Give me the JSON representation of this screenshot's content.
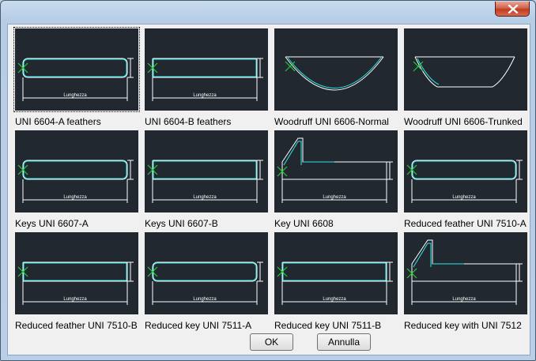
{
  "window": {
    "close_icon": "close-icon",
    "colors": {
      "thumbnail_bg": "#222830",
      "profile_line": "#ffffff",
      "profile_fill_line": "#2ee6e6",
      "marker": "#22cc33"
    }
  },
  "items": [
    {
      "label": "UNI 6604-A feathers",
      "shape": "rect-slot",
      "selected": true
    },
    {
      "label": "UNI 6604-B feathers",
      "shape": "rect-flat",
      "selected": false
    },
    {
      "label": "Woodruff UNI 6606-Normal",
      "shape": "half-moon",
      "selected": false
    },
    {
      "label": "Woodruff UNI 6606-Trunked",
      "shape": "half-moon-truncated",
      "selected": false
    },
    {
      "label": "Keys UNI 6607-A",
      "shape": "rect-slot",
      "selected": false
    },
    {
      "label": "Keys UNI 6607-B",
      "shape": "rect-flat",
      "selected": false
    },
    {
      "label": "Key UNI 6608",
      "shape": "gib-head",
      "selected": false
    },
    {
      "label": "Reduced feather UNI 7510-A",
      "shape": "rect-slot",
      "selected": false
    },
    {
      "label": "Reduced feather UNI 7510-B",
      "shape": "rect-flat",
      "selected": false
    },
    {
      "label": "Reduced key UNI 7511-A",
      "shape": "rect-slot",
      "selected": false
    },
    {
      "label": "Reduced key UNI 7511-B",
      "shape": "rect-flat",
      "selected": false
    },
    {
      "label": "Reduced key with UNI 7512",
      "shape": "gib-head",
      "selected": false
    }
  ],
  "thumbnail_dimension_text": "Lunghezza",
  "buttons": {
    "ok": "OK",
    "cancel": "Annulla"
  }
}
